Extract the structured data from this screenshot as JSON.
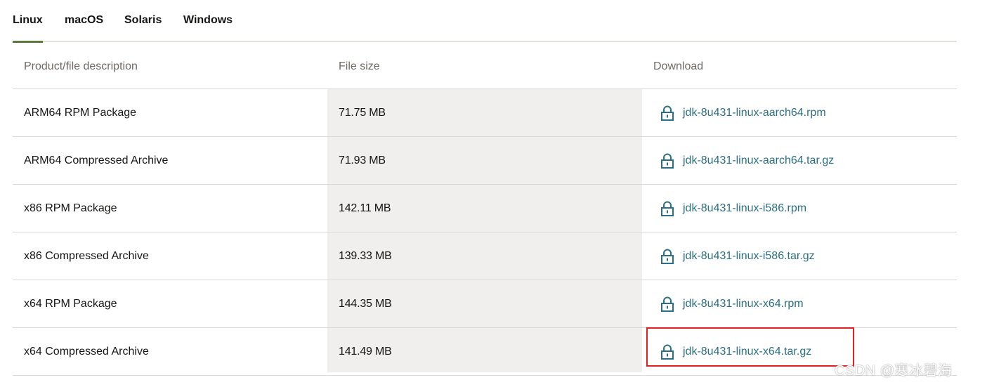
{
  "tabs": [
    {
      "label": "Linux",
      "active": true
    },
    {
      "label": "macOS",
      "active": false
    },
    {
      "label": "Solaris",
      "active": false
    },
    {
      "label": "Windows",
      "active": false
    }
  ],
  "table": {
    "headers": [
      "Product/file description",
      "File size",
      "Download"
    ],
    "rows": [
      {
        "description": "ARM64 RPM Package",
        "size": "71.75 MB",
        "file": "jdk-8u431-linux-aarch64.rpm"
      },
      {
        "description": "ARM64 Compressed Archive",
        "size": "71.93 MB",
        "file": "jdk-8u431-linux-aarch64.tar.gz"
      },
      {
        "description": "x86 RPM Package",
        "size": "142.11 MB",
        "file": "jdk-8u431-linux-i586.rpm"
      },
      {
        "description": "x86 Compressed Archive",
        "size": "139.33 MB",
        "file": "jdk-8u431-linux-i586.tar.gz"
      },
      {
        "description": "x64 RPM Package",
        "size": "144.35 MB",
        "file": "jdk-8u431-linux-x64.rpm"
      },
      {
        "description": "x64 Compressed Archive",
        "size": "141.49 MB",
        "file": "jdk-8u431-linux-x64.tar.gz"
      }
    ]
  },
  "icons": {
    "download": "lock-icon"
  },
  "colors": {
    "link": "#2a6f82",
    "active_tab_underline": "#5a7a3a",
    "highlight_box": "#e02020",
    "size_column_bg": "#f1efed"
  },
  "watermark": "CSDN @寒冰碧海"
}
